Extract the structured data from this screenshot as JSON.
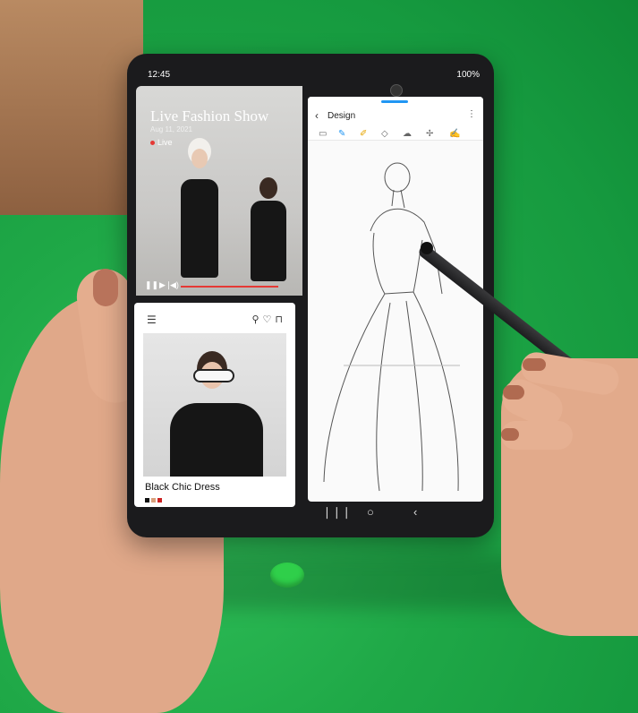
{
  "phone": {
    "status_time": "12:45",
    "status_battery": "100%",
    "video": {
      "title": "Live Fashion Show",
      "date": "Aug 11, 2021",
      "live_label": "Live",
      "progress": 0.85
    },
    "shop": {
      "product_name": "Black Chic Dress"
    },
    "sketch_app": {
      "title": "Design"
    }
  }
}
